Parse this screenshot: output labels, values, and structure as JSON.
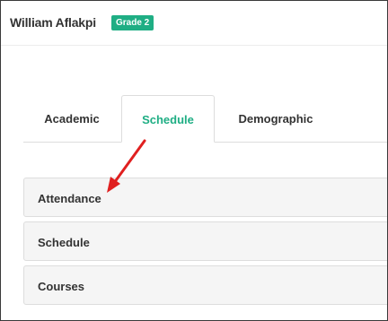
{
  "header": {
    "student_name": "William Aflakpi",
    "grade_badge": "Grade 2"
  },
  "tabs": [
    {
      "label": "Academic",
      "active": false
    },
    {
      "label": "Schedule",
      "active": true
    },
    {
      "label": "Demographic",
      "active": false
    }
  ],
  "panels": [
    {
      "title": "Attendance"
    },
    {
      "title": "Schedule"
    },
    {
      "title": "Courses"
    }
  ],
  "colors": {
    "accent": "#1fae84",
    "annotation_arrow": "#e02020",
    "panel_background": "#f5f5f5"
  }
}
